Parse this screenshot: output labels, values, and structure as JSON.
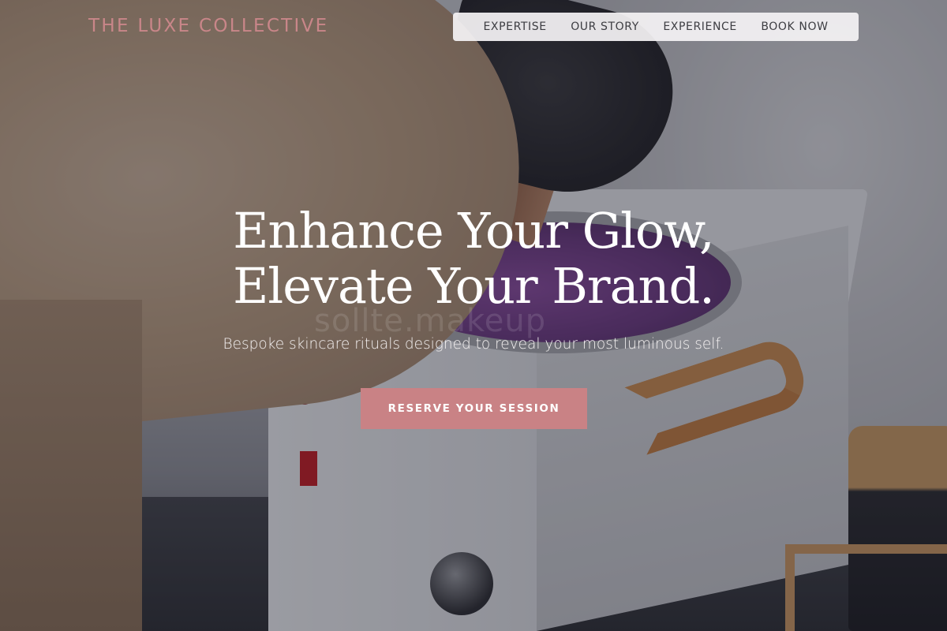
{
  "header": {
    "brand": "THE LUXE COLLECTIVE",
    "nav": [
      {
        "label": "EXPERTISE"
      },
      {
        "label": "OUR STORY"
      },
      {
        "label": "EXPERIENCE"
      },
      {
        "label": "BOOK NOW"
      }
    ]
  },
  "hero": {
    "title_line1": "Enhance Your Glow,",
    "title_line2": "Elevate Your Brand.",
    "watermark": "sollte.makeup",
    "subtitle": "Bespoke skincare rituals designed to reveal your most luminous self.",
    "cta_label": "RESERVE YOUR SESSION"
  },
  "colors": {
    "accent": "#c98285",
    "brand_text": "#c98689",
    "nav_background": "#f4f2f4"
  }
}
